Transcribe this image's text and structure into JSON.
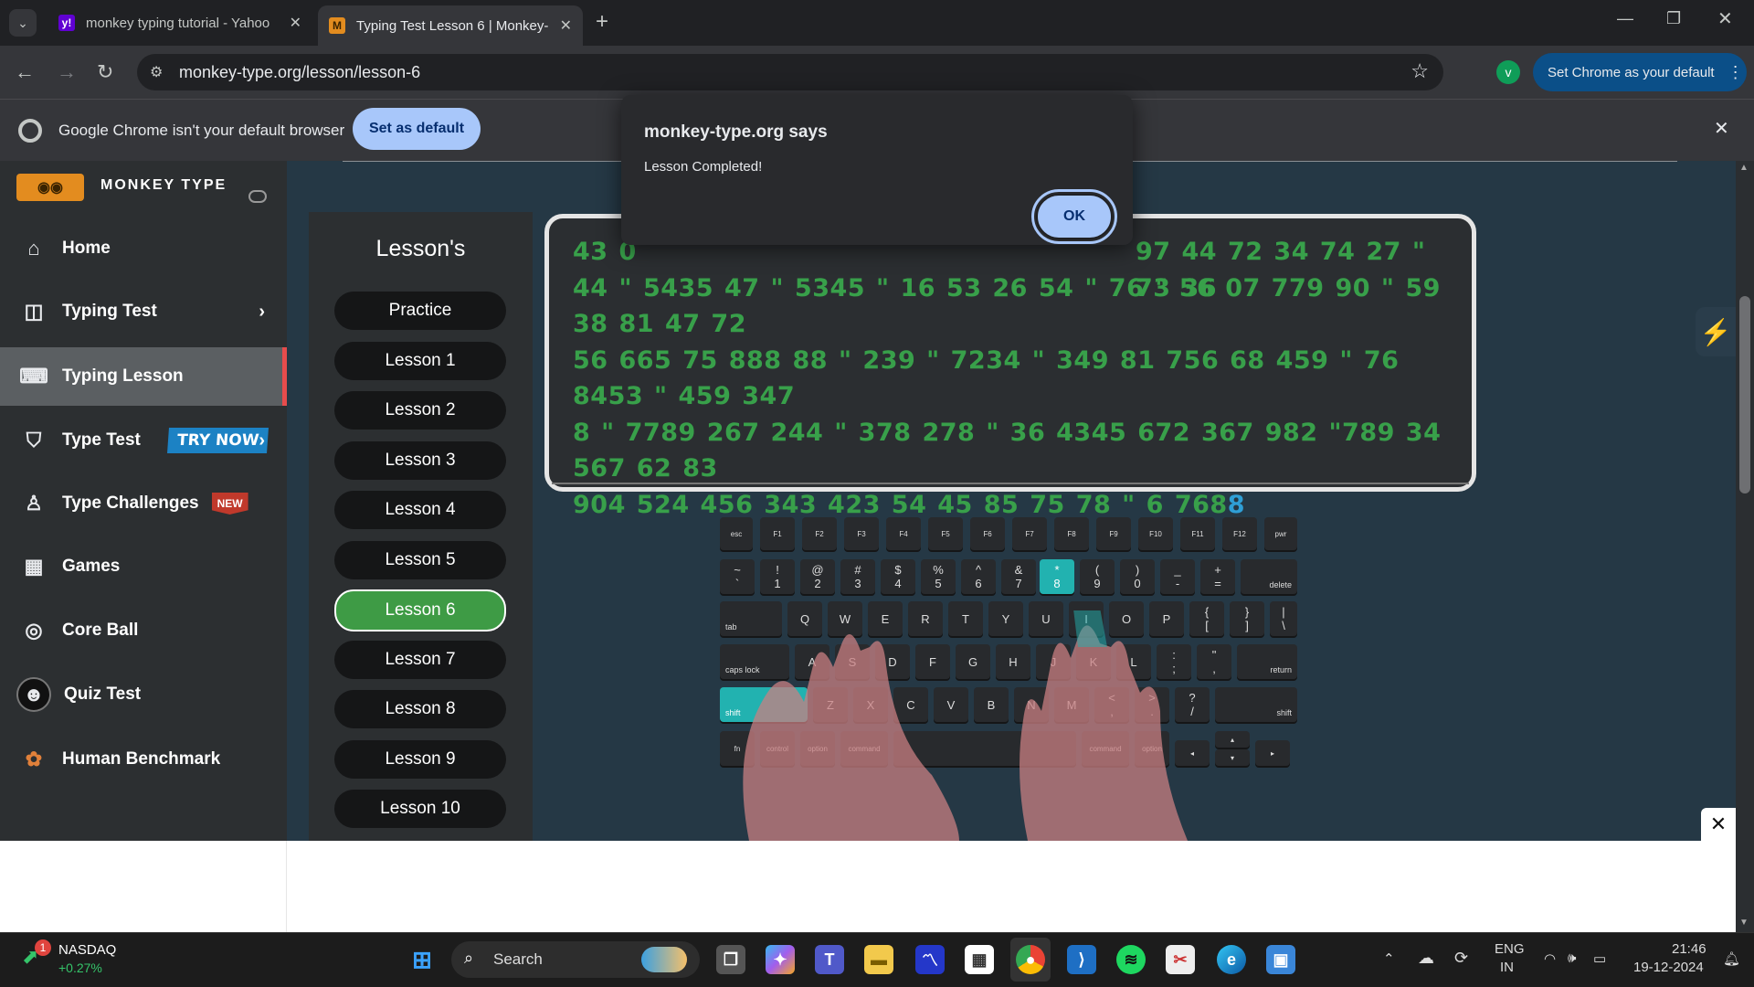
{
  "browser": {
    "tabs": [
      {
        "title": "monkey typing tutorial - Yahoo",
        "favicon": "y!"
      },
      {
        "title": "Typing Test Lesson 6 | Monkey-",
        "favicon": "M"
      }
    ],
    "url": "monkey-type.org/lesson/lesson-6",
    "profile_initial": "v",
    "set_default_pill": "Set Chrome as your default",
    "infobar_text": "Google Chrome isn't your default browser",
    "infobar_button": "Set as default"
  },
  "dialog": {
    "title": "monkey-type.org says",
    "message": "Lesson Completed!",
    "ok_label": "OK"
  },
  "site": {
    "brand": "MONKEY TYPE",
    "nav": [
      {
        "label": "Home",
        "icon": "home-icon"
      },
      {
        "label": "Typing Test",
        "icon": "test-icon"
      },
      {
        "label": "Typing Lesson",
        "icon": "keyboard-icon"
      },
      {
        "label": "Type Test",
        "icon": "gitlab-icon",
        "badge": "TRY NOW"
      },
      {
        "label": "Type Challenges",
        "icon": "award-icon",
        "badge": "NEW"
      },
      {
        "label": "Games",
        "icon": "grid-icon"
      },
      {
        "label": "Core Ball",
        "icon": "target-icon"
      },
      {
        "label": "Quiz Test",
        "icon": "quiz-icon"
      },
      {
        "label": "Human Benchmark",
        "icon": "benchmark-icon"
      }
    ],
    "lessons_title": "Lesson's",
    "lessons": [
      "Practice",
      "Lesson 1",
      "Lesson 2",
      "Lesson 3",
      "Lesson 4",
      "Lesson 5",
      "Lesson 6",
      "Lesson 7",
      "Lesson 8",
      "Lesson 9",
      "Lesson 10"
    ],
    "active_lesson": "Lesson 6",
    "text_lines": [
      "43 0",
      "44 \" 5435 47 \" 5345 \" 16 53 26 54 \" 76 \" 56 07 779 90 \" 59 38 81 47 72",
      "56 665 75 888 88 \" 239 \" 7234 \" 349 81 756 68 459 \" 76 8453 \" 459 347",
      "8 \" 7789 267 244 \" 378 278 \" 36 4345 672 367 982 \"789 34 567 62 83",
      "904 524 456 343 423 54 45 85 75 78 \" 6 768"
    ],
    "text_line1_tail": "97 44 72 34 74 27 \" 73 36",
    "text_cursor_char": "8"
  },
  "keyboard": {
    "row0": [
      "esc",
      "F1",
      "F2",
      "F3",
      "F4",
      "F5",
      "F6",
      "F7",
      "F8",
      "F9",
      "F10",
      "F11",
      "F12",
      "pwr"
    ],
    "row1": [
      [
        "~",
        "`"
      ],
      [
        "!",
        "1"
      ],
      [
        "@",
        "2"
      ],
      [
        "#",
        "3"
      ],
      [
        "$",
        "4"
      ],
      [
        "%",
        "5"
      ],
      [
        "^",
        "6"
      ],
      [
        "&",
        "7"
      ],
      [
        "*",
        "8"
      ],
      [
        "(",
        "9"
      ],
      [
        ")",
        "0"
      ],
      [
        "_",
        "-"
      ],
      [
        "+",
        "="
      ]
    ],
    "row1_delete": "delete",
    "row2_tab": "tab",
    "row2": [
      "Q",
      "W",
      "E",
      "R",
      "T",
      "Y",
      "U",
      "I",
      "O",
      "P"
    ],
    "row2_sym": [
      [
        "{",
        "["
      ],
      [
        "}",
        "]"
      ],
      [
        "|",
        "\\"
      ]
    ],
    "row3_caps": "caps lock",
    "row3": [
      "A",
      "S",
      "D",
      "F",
      "G",
      "H",
      "J",
      "K",
      "L"
    ],
    "row3_sym": [
      [
        ":",
        ";"
      ],
      [
        "\"",
        ","
      ]
    ],
    "row3_return": "return",
    "row4_shift": "shift",
    "row4": [
      "Z",
      "X",
      "C",
      "V",
      "B",
      "N",
      "M"
    ],
    "row4_sym": [
      [
        "<",
        ","
      ],
      [
        ">",
        "."
      ],
      [
        "?",
        "/"
      ]
    ],
    "row4_shift_r": "shift",
    "row5": [
      "fn",
      "control",
      "option",
      "command",
      "command",
      "option"
    ],
    "arrows": [
      "◂",
      "▴",
      "▾",
      "▸"
    ]
  },
  "taskbar": {
    "stock_name": "NASDAQ",
    "stock_change": "+0.27%",
    "stock_badge": "1",
    "search": "Search",
    "lang": "ENG",
    "region": "IN",
    "time": "21:46",
    "date": "19-12-2024"
  },
  "colors": {
    "accent_green": "#38a04a",
    "active_lesson": "#3e9b45",
    "highlight_key": "#22b2b0",
    "chrome_blue": "#a8c7fa"
  }
}
